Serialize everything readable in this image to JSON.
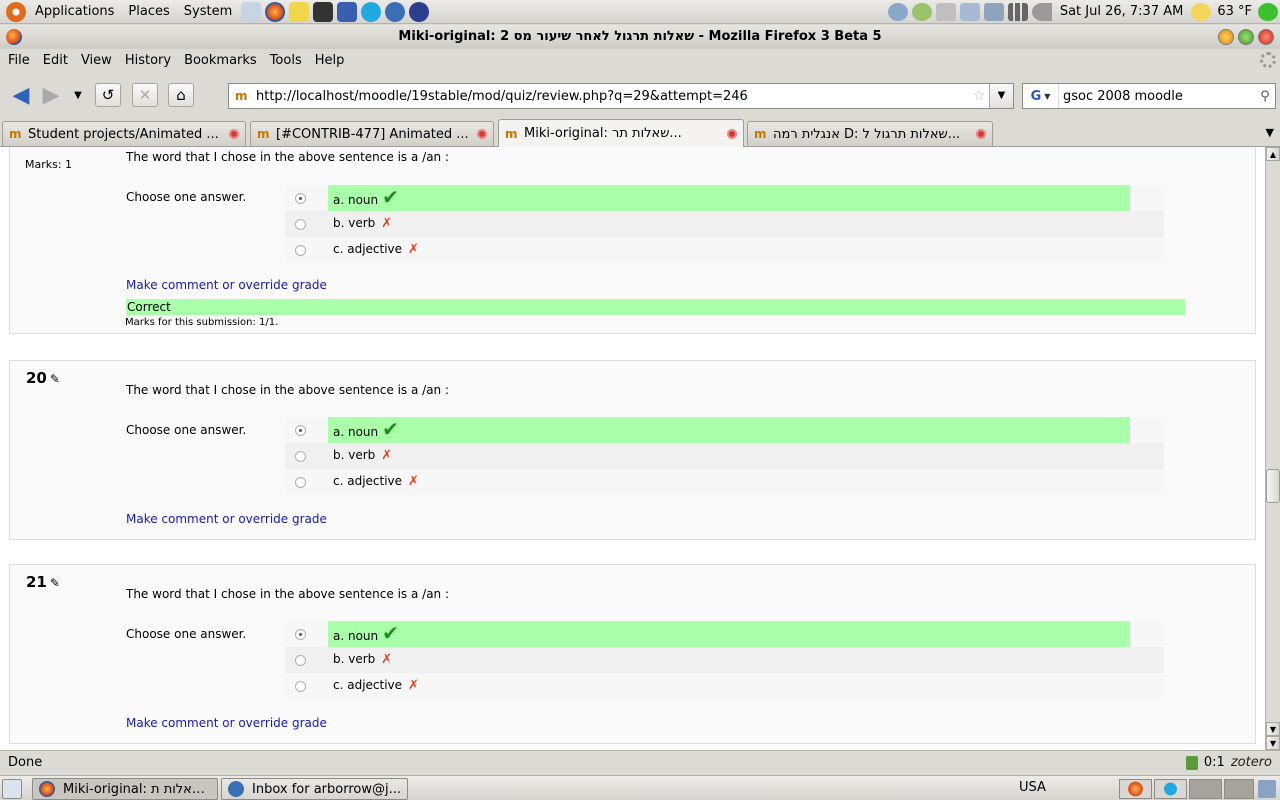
{
  "top_panel": {
    "menus": [
      "Applications",
      "Places",
      "System"
    ],
    "clock": "Sat Jul 26,  7:37 AM",
    "weather": "63 °F"
  },
  "window": {
    "title": "Miki-original: 2 שאלות תרגול לאחר שיעור מס - Mozilla Firefox 3 Beta 5"
  },
  "menubar": [
    "File",
    "Edit",
    "View",
    "History",
    "Bookmarks",
    "Tools",
    "Help"
  ],
  "navbar": {
    "url": "http://localhost/moodle/19stable/mod/quiz/review.php?q=29&attempt=246",
    "search_value": "gsoc 2008 moodle",
    "search_engine_letter": "G"
  },
  "tabs": [
    {
      "label": "Student projects/Animated ...",
      "favicon": "m"
    },
    {
      "label": "[#CONTRIB-477] Animated ...",
      "favicon": "m"
    },
    {
      "label": "Miki-original: שאלות תר...",
      "favicon": "m"
    },
    {
      "label": "אנגלית רמה D: שאלות תרגול ל...",
      "favicon": "m"
    }
  ],
  "questions": [
    {
      "number": "",
      "marks_label": "Marks: 1",
      "text": "The word that I chose in the above sentence is a /an :",
      "prompt": "Choose one answer.",
      "answers": [
        {
          "label": "a. noun",
          "correct": true,
          "selected": true
        },
        {
          "label": "b. verb",
          "correct": false,
          "selected": false
        },
        {
          "label": "c. adjective",
          "correct": false,
          "selected": false
        }
      ],
      "comment_link": "Make comment or override grade",
      "feedback": "Correct",
      "marks_submission": "Marks for this submission: 1/1."
    },
    {
      "number": "20",
      "text": "The word that I chose in the above sentence is a /an :",
      "prompt": "Choose one answer.",
      "answers": [
        {
          "label": "a. noun",
          "correct": true,
          "selected": true
        },
        {
          "label": "b. verb",
          "correct": false,
          "selected": false
        },
        {
          "label": "c. adjective",
          "correct": false,
          "selected": false
        }
      ],
      "comment_link": "Make comment or override grade"
    },
    {
      "number": "21",
      "text": "The word that I chose in the above sentence is a /an :",
      "prompt": "Choose one answer.",
      "answers": [
        {
          "label": "a. noun",
          "correct": true,
          "selected": true
        },
        {
          "label": "b. verb",
          "correct": false,
          "selected": false
        },
        {
          "label": "c. adjective",
          "correct": false,
          "selected": false
        }
      ],
      "comment_link": "Make comment or override grade"
    }
  ],
  "statusbar": {
    "text": "Done",
    "counter": "0:1",
    "zotero": "zotero"
  },
  "taskbar": {
    "tasks": [
      "Miki-original: שאלות ת...",
      "Inbox for arborrow@j..."
    ],
    "keyboard_layout": "USA"
  },
  "colors": {
    "correct_bg": "#aaffaa",
    "link": "#1a1aa6",
    "tick": "#1c8f1c",
    "cross": "#e04020"
  }
}
